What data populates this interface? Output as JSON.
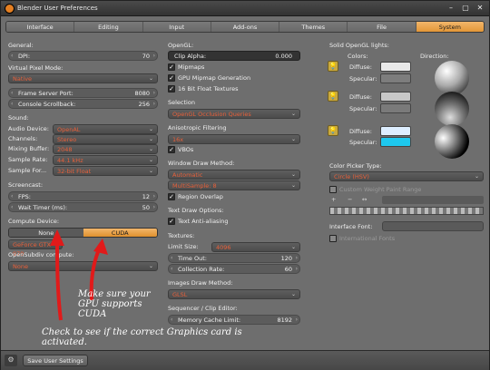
{
  "window": {
    "title": "Blender User Preferences"
  },
  "tabs": [
    "Interface",
    "Editing",
    "Input",
    "Add-ons",
    "Themes",
    "File",
    "System"
  ],
  "general": {
    "header": "General:",
    "dpi_label": "DPI:",
    "dpi": "70"
  },
  "virtual_pixel": {
    "header": "Virtual Pixel Mode:",
    "value": "Native"
  },
  "frame_server": {
    "label": "Frame Server Port:",
    "value": "8080"
  },
  "console": {
    "label": "Console Scrollback:",
    "value": "256"
  },
  "sound": {
    "header": "Sound:",
    "rows": [
      {
        "label": "Audio Device:",
        "value": "OpenAL"
      },
      {
        "label": "Channels:",
        "value": "Stereo"
      },
      {
        "label": "Mixing Buffer:",
        "value": "2048"
      },
      {
        "label": "Sample Rate:",
        "value": "44.1 kHz"
      },
      {
        "label": "Sample For...",
        "value": "32-bit Float"
      }
    ]
  },
  "screencast": {
    "header": "Screencast:",
    "fps_label": "FPS:",
    "fps": "12",
    "wait_label": "Wait Timer (ms):",
    "wait": "50"
  },
  "compute": {
    "header": "Compute Device:",
    "none": "None",
    "cuda": "CUDA",
    "device": "GeForce GTX 970",
    "opensubdiv_label": "OpenSubdiv compute:",
    "opensubdiv": "None"
  },
  "opengl": {
    "header": "OpenGL:",
    "clip_label": "Clip Alpha:",
    "clip": "0.000",
    "mipmaps": "Mipmaps",
    "gpu_mipmap": "GPU Mipmap Generation",
    "float_tex": "16 Bit Float Textures"
  },
  "selection": {
    "header": "Selection",
    "value": "OpenGL Occlusion Queries"
  },
  "aniso": {
    "header": "Anisotropic Filtering",
    "value": "16x",
    "vbos": "VBOs"
  },
  "window_draw": {
    "header": "Window Draw Method:",
    "value": "Automatic",
    "multisample": "MultiSample: 8",
    "region_overlap": "Region Overlap"
  },
  "text_draw": {
    "header": "Text Draw Options:",
    "antialias": "Text Anti-aliasing"
  },
  "textures": {
    "header": "Textures:",
    "limit_label": "Limit Size:",
    "limit": "4096",
    "timeout_label": "Time Out:",
    "timeout": "120",
    "collection_label": "Collection Rate:",
    "collection": "60"
  },
  "images_draw": {
    "header": "Images Draw Method:",
    "value": "GLSL"
  },
  "sequencer": {
    "header": "Sequencer / Clip Editor:",
    "mem_label": "Memory Cache Limit:",
    "mem": "8192"
  },
  "solid_lights": {
    "header": "Solid OpenGL lights:",
    "colors_label": "Colors:",
    "direction_label": "Direction:",
    "diffuse": "Diffuse:",
    "specular": "Specular:",
    "lights": [
      {
        "diffuse": "#e9e9e9",
        "specular": "#7d7d7d"
      },
      {
        "diffuse": "#c8c8c8",
        "specular": "#7a7a7a"
      },
      {
        "diffuse": "#ddeeff",
        "specular": "#1ec8ee"
      }
    ]
  },
  "color_picker": {
    "header": "Color Picker Type:",
    "value": "Circle (HSV)",
    "custom_weight": "Custom Weight Paint Range",
    "plus": "+",
    "minus": "−",
    "arrows": "↔"
  },
  "interface_font": {
    "label": "Interface Font:",
    "intl": "International Fonts"
  },
  "annotations": {
    "gpu": [
      "Make sure your",
      "GPU supports",
      "CUDA"
    ],
    "check": [
      "Check to see if the correct Graphics card is",
      "activated."
    ]
  },
  "footer": {
    "save": "Save User Settings"
  },
  "colors": {
    "accent": "#e8903a",
    "window_bg": "#6e6e6e"
  }
}
